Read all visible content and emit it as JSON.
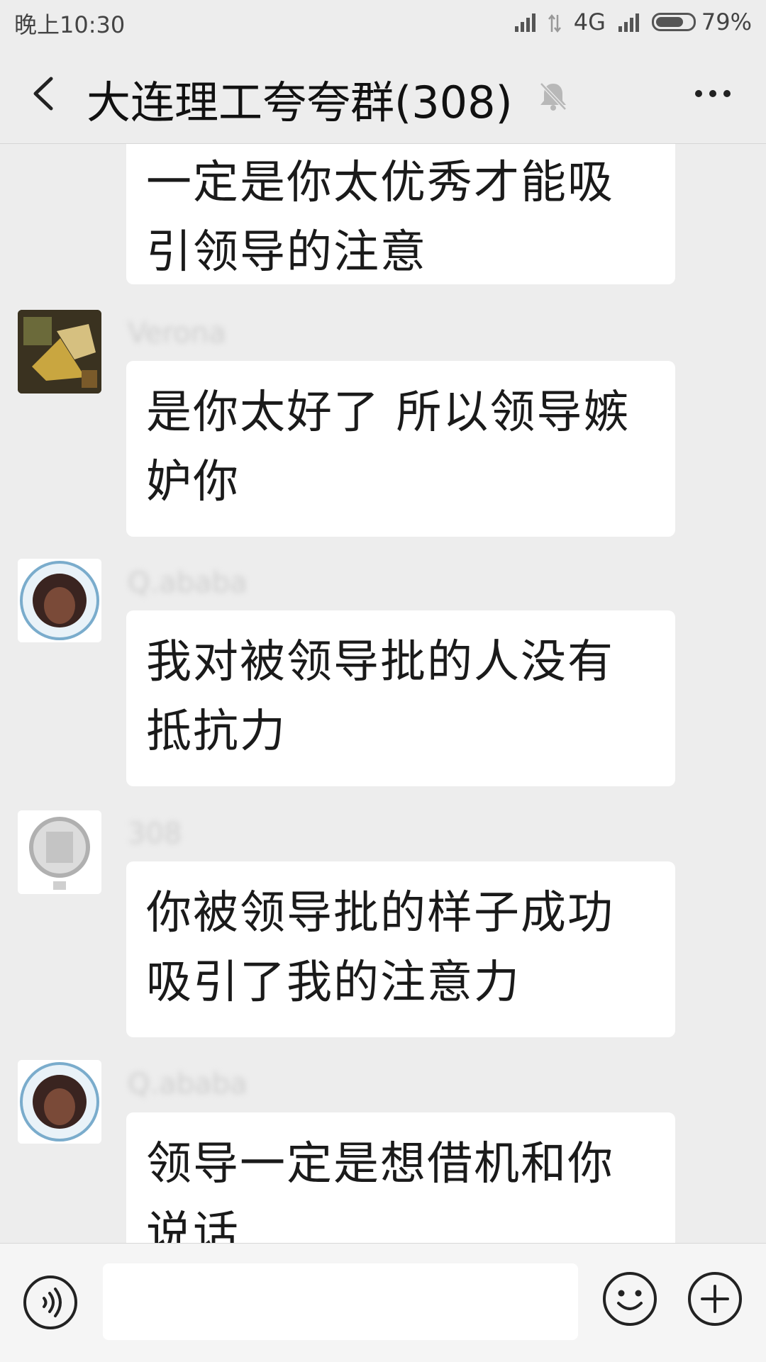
{
  "status_bar": {
    "time": "晚上10:30",
    "network": "4G",
    "battery_percent": "79%",
    "battery_level": 0.79
  },
  "header": {
    "title": "大连理工夸夸群(308)",
    "back_icon": "chevron-left-icon",
    "mute_icon": "bell-off-icon",
    "more_icon": "more-dots-icon"
  },
  "messages": [
    {
      "text": "一定是你太优秀才能吸引领导的注意"
    },
    {
      "sender": "Verona",
      "text": "是你太好了 所以领导嫉妒你"
    },
    {
      "sender": "Q.ababa",
      "text": "我对被领导批的人没有抵抗力"
    },
    {
      "sender": "308",
      "text": "你被领导批的样子成功吸引了我的注意力"
    },
    {
      "sender": "Q.ababa",
      "text": "领导一定是想借机和你说话"
    }
  ],
  "input_bar": {
    "voice_icon": "voice-icon",
    "input_value": "",
    "emoji_icon": "emoji-icon",
    "plus_icon": "plus-icon"
  },
  "colors": {
    "background": "#ededed",
    "bubble": "#ffffff",
    "text": "#1a1a1a"
  }
}
